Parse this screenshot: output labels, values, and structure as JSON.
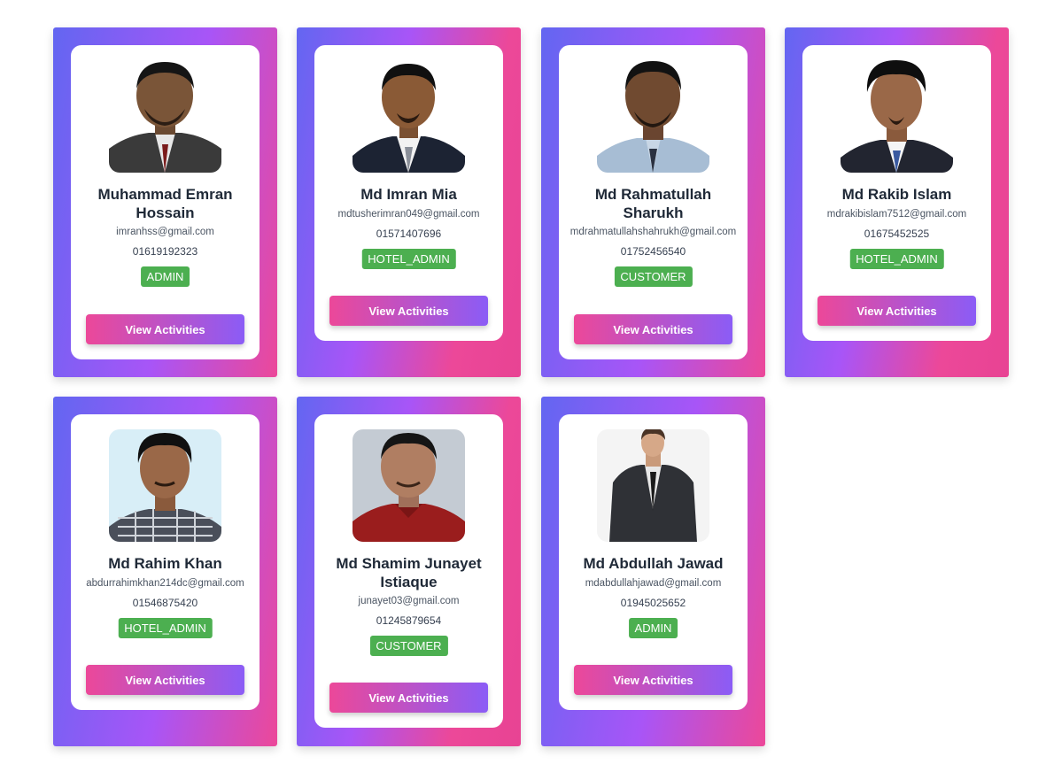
{
  "users": [
    {
      "name": "Muhammad Emran Hossain",
      "email": "imranhss@gmail.com",
      "phone": "01619192323",
      "role": "ADMIN",
      "button": "View Activities"
    },
    {
      "name": "Md Imran Mia",
      "email": "mdtusherimran049@gmail.com",
      "phone": "01571407696",
      "role": "HOTEL_ADMIN",
      "button": "View Activities"
    },
    {
      "name": "Md Rahmatullah Sharukh",
      "email": "mdrahmatullahshahrukh@gmail.com",
      "phone": "01752456540",
      "role": "CUSTOMER",
      "button": "View Activities"
    },
    {
      "name": "Md Rakib Islam",
      "email": "mdrakibislam7512@gmail.com",
      "phone": "01675452525",
      "role": "HOTEL_ADMIN",
      "button": "View Activities"
    },
    {
      "name": "Md Rahim Khan",
      "email": "abdurrahimkhan214dc@gmail.com",
      "phone": "01546875420",
      "role": "HOTEL_ADMIN",
      "button": "View Activities"
    },
    {
      "name": "Md Shamim Junayet Istiaque",
      "email": "junayet03@gmail.com",
      "phone": "01245879654",
      "role": "CUSTOMER",
      "button": "View Activities"
    },
    {
      "name": "Md Abdullah Jawad",
      "email": "mdabdullahjawad@gmail.com",
      "phone": "01945025652",
      "role": "ADMIN",
      "button": "View Activities"
    }
  ],
  "colors": {
    "gradient_start": "#6366f1",
    "gradient_mid": "#a855f7",
    "gradient_end": "#ec4899",
    "role_badge": "#4caf50"
  }
}
